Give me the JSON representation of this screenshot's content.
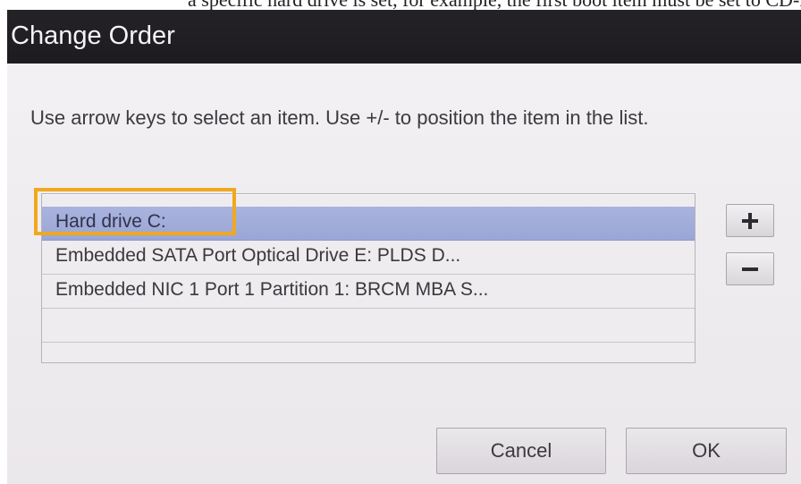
{
  "fragment_text": "a specific hard drive is set, for example, the first boot item must be set to CD-ROM",
  "dialog": {
    "title": "Change Order",
    "instructions": "Use arrow keys to select an item. Use +/- to position the item in the list.",
    "boot_items": [
      {
        "label": "Hard drive C:",
        "selected": true
      },
      {
        "label": "Embedded SATA Port Optical Drive E: PLDS D...",
        "selected": false
      },
      {
        "label": "Embedded NIC 1 Port 1 Partition 1: BRCM MBA S...",
        "selected": false
      },
      {
        "label": "",
        "selected": false
      }
    ],
    "move_up_label": "+",
    "move_down_label": "-",
    "cancel_label": "Cancel",
    "ok_label": "OK"
  },
  "colors": {
    "titlebar": "#1f1d21",
    "dialog_bg": "#efedef",
    "selected_row": "#a2addb",
    "highlight_box": "#f0a81e"
  },
  "icons": {
    "move_up": "plus-icon",
    "move_down": "minus-icon"
  }
}
